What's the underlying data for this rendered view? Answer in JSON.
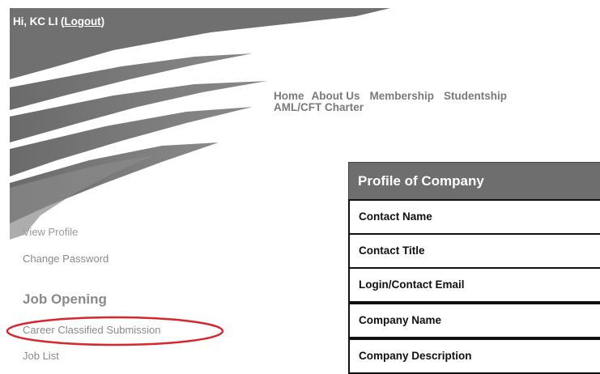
{
  "header": {
    "greeting": "Hi, KC LI",
    "logout_label": "Logout",
    "open_paren": "(",
    "close_paren": ")"
  },
  "nav": {
    "items": [
      {
        "label": "Home"
      },
      {
        "label": "About Us"
      },
      {
        "label": "Membership"
      },
      {
        "label": "Studentship"
      },
      {
        "label": "AML/CFT Charter"
      }
    ]
  },
  "sidebar": {
    "view_profile": "View Profile",
    "change_password": "Change Password",
    "job_heading": "Job Opening",
    "career_submission": "Career Classified Submission",
    "job_list": "Job List"
  },
  "panel": {
    "title": "Profile of Company",
    "rows": [
      {
        "label": "Contact Name"
      },
      {
        "label": "Contact Title"
      },
      {
        "label": "Login/Contact Email"
      },
      {
        "label": "Company Name"
      },
      {
        "label": "Company Description"
      }
    ]
  },
  "colors": {
    "banner": "#767676",
    "nav_text": "#7a7a7a",
    "panel_header": "#6e6e6e",
    "highlight": "#d9252e"
  }
}
